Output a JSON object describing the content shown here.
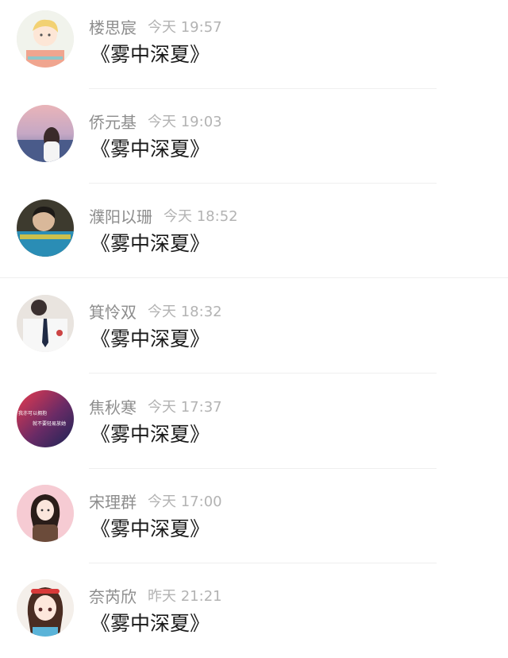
{
  "messages": [
    {
      "name": "楼思宸",
      "time": "今天 19:57",
      "text": "《雾中深夏》",
      "avatar_icon": "cartoon-boy-avatar"
    },
    {
      "name": "侨元基",
      "time": "今天 19:03",
      "text": "《雾中深夏》",
      "avatar_icon": "beach-girl-avatar"
    },
    {
      "name": "濮阳以珊",
      "time": "今天 18:52",
      "text": "《雾中深夏》",
      "avatar_icon": "boy-photo-avatar"
    },
    {
      "name": "箕怜双",
      "time": "今天 18:32",
      "text": "《雾中深夏》",
      "avatar_icon": "school-uniform-avatar"
    },
    {
      "name": "焦秋寒",
      "time": "今天 17:37",
      "text": "《雾中深夏》",
      "avatar_icon": "text-gradient-avatar",
      "avatar_text": [
        "我亦可以拥抱",
        "就不要轻易放她"
      ]
    },
    {
      "name": "宋理群",
      "time": "今天 17:00",
      "text": "《雾中深夏》",
      "avatar_icon": "illustrated-girl-avatar"
    },
    {
      "name": "奈芮欣",
      "time": "昨天 21:21",
      "text": "《雾中深夏》",
      "avatar_icon": "anime-girl-avatar"
    }
  ]
}
